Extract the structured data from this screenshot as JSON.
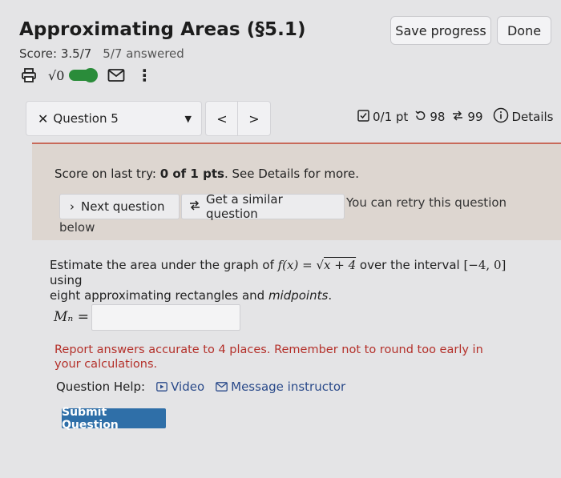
{
  "header": {
    "title": "Approximating Areas (§5.1)",
    "score": "Score: 3.5/7",
    "answered": "5/7 answered",
    "save_label": "Save progress",
    "done_label": "Done"
  },
  "toolbar": {
    "sqrt_label": "√0",
    "icons": [
      "printer-icon",
      "sqrt-icon",
      "toggle-icon",
      "mail-icon",
      "kebab-icon"
    ]
  },
  "question_nav": {
    "selected": "Question 5",
    "prev": "<",
    "next": ">",
    "points": "0/1 pt",
    "retries": "98",
    "similar_count": "99",
    "details": "Details"
  },
  "feedback": {
    "last_try_prefix": "Score on last try: ",
    "last_try_value": "0 of 1 pts",
    "last_try_suffix": ". See Details for more.",
    "next_question": "Next question",
    "similar_question": "Get a similar question",
    "retry_text": "You can retry this question",
    "retry_below": "below"
  },
  "problem": {
    "prefix": "Estimate the area under the graph of ",
    "function_lhs": "f(x)",
    "function_eq": " = √",
    "function_rhs": "x + 4",
    "interval_text": " over the interval ",
    "interval": "[−4, 0]",
    "using": " using",
    "line2_a": "eight approximating rectangles and ",
    "line2_b": "midpoints",
    "line2_c": ".",
    "answer_label": "Mₙ =",
    "answer_value": ""
  },
  "report": "Report answers accurate to 4 places. Remember not to round too early in your calculations.",
  "help": {
    "label": "Question Help:",
    "video": "Video",
    "message": "Message instructor"
  },
  "submit_label": "Submit Question",
  "colors": {
    "accent_green": "#2a8c3a",
    "submit_blue": "#2f6fa8",
    "error_red": "#b4302a",
    "panel_bg": "#ddd6d0"
  }
}
